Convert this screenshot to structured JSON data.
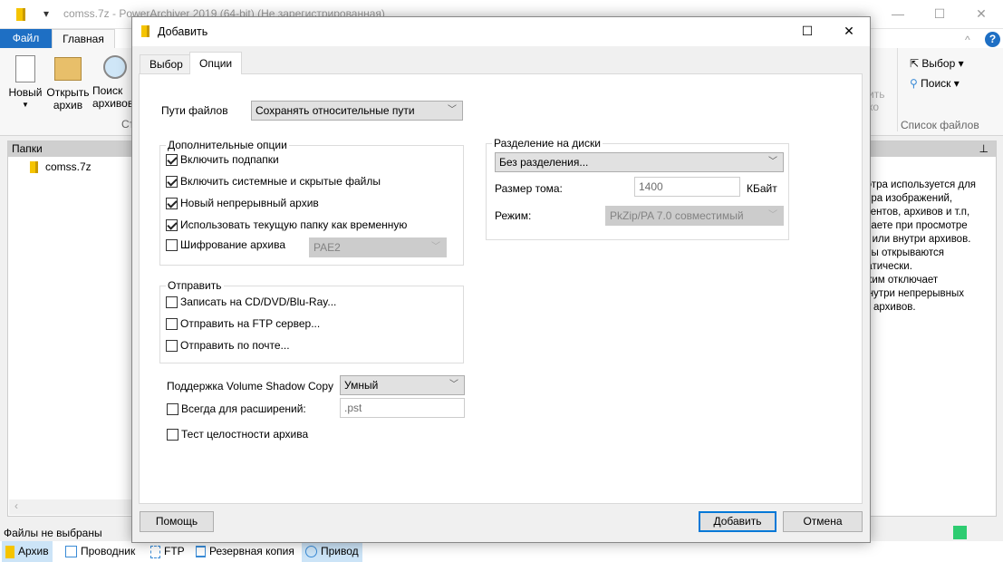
{
  "app": {
    "title": "comss.7z - PowerArchiver 2019 (64-bit) (Не зарегистрированная)",
    "ribbon_tabs": [
      "Файл",
      "Главная"
    ],
    "ribbon_buttons": [
      {
        "label": "Новый",
        "icon": "new-file-icon"
      },
      {
        "label": "Открыть архив",
        "icon": "folder-icon"
      },
      {
        "label": "Поиск архивов",
        "icon": "search-icon"
      }
    ],
    "ribbon_group_partial": "Ст",
    "right_ribbon": {
      "select": "Выбор",
      "search": "Поиск",
      "group": "Список файлов",
      "partial": "ить\nко"
    },
    "folders_panel": {
      "title": "Папки",
      "items": [
        "comss.7z"
      ]
    },
    "preview_text": [
      "смотра используется для",
      "мотра изображений,",
      "кументов, архивов и т.п,",
      "бираете при просмотре",
      "ках или внутри архивов.",
      "айлы открываются",
      "оматически.",
      "режим отключает",
      "р внутри непрерывных",
      "архивов."
    ],
    "status": "Файлы не выбраны",
    "bottom_tabs": [
      {
        "label": "Архив",
        "icon": "archive-icon"
      },
      {
        "label": "Проводник",
        "icon": "explorer-icon"
      },
      {
        "label": "FTP",
        "icon": "ftp-icon"
      },
      {
        "label": "Резервная копия",
        "icon": "backup-icon"
      },
      {
        "label": "Привод",
        "icon": "drive-icon"
      }
    ],
    "status_color": "#2ecc71"
  },
  "dialog": {
    "title": "Добавить",
    "tabs": [
      "Выбор",
      "Опции"
    ],
    "active_tab": "Опции",
    "file_paths_label": "Пути файлов",
    "file_paths_value": "Сохранять относительные пути",
    "extra": {
      "legend": "Дополнительные опции",
      "items": [
        {
          "label": "Включить подпапки",
          "checked": true
        },
        {
          "label": "Включить системные и скрытые файлы",
          "checked": true
        },
        {
          "label": "Новый непрерывный архив",
          "checked": true
        },
        {
          "label": "Использовать текущую папку как временную",
          "checked": true
        },
        {
          "label": "Шифрование архива",
          "checked": false
        }
      ],
      "encryption_value": "PAE2"
    },
    "send": {
      "legend": "Отправить",
      "items": [
        {
          "label": "Записать на CD/DVD/Blu-Ray...",
          "checked": false
        },
        {
          "label": "Отправить на FTP сервер...",
          "checked": false
        },
        {
          "label": "Отправить по почте...",
          "checked": false
        }
      ]
    },
    "vss_label": "Поддержка Volume Shadow Copy",
    "vss_value": "Умный",
    "always_ext": {
      "label": "Всегда для расширений:",
      "checked": false,
      "value": ".pst"
    },
    "test": {
      "label": "Тест целостности архива",
      "checked": false
    },
    "split": {
      "legend": "Разделение на диски",
      "value": "Без разделения...",
      "size_label": "Размер тома:",
      "size_value": "1400",
      "size_unit": "КБайт",
      "mode_label": "Режим:",
      "mode_value": "PkZip/PA 7.0 совместимый"
    },
    "buttons": {
      "help": "Помощь",
      "add": "Добавить",
      "cancel": "Отмена"
    }
  }
}
